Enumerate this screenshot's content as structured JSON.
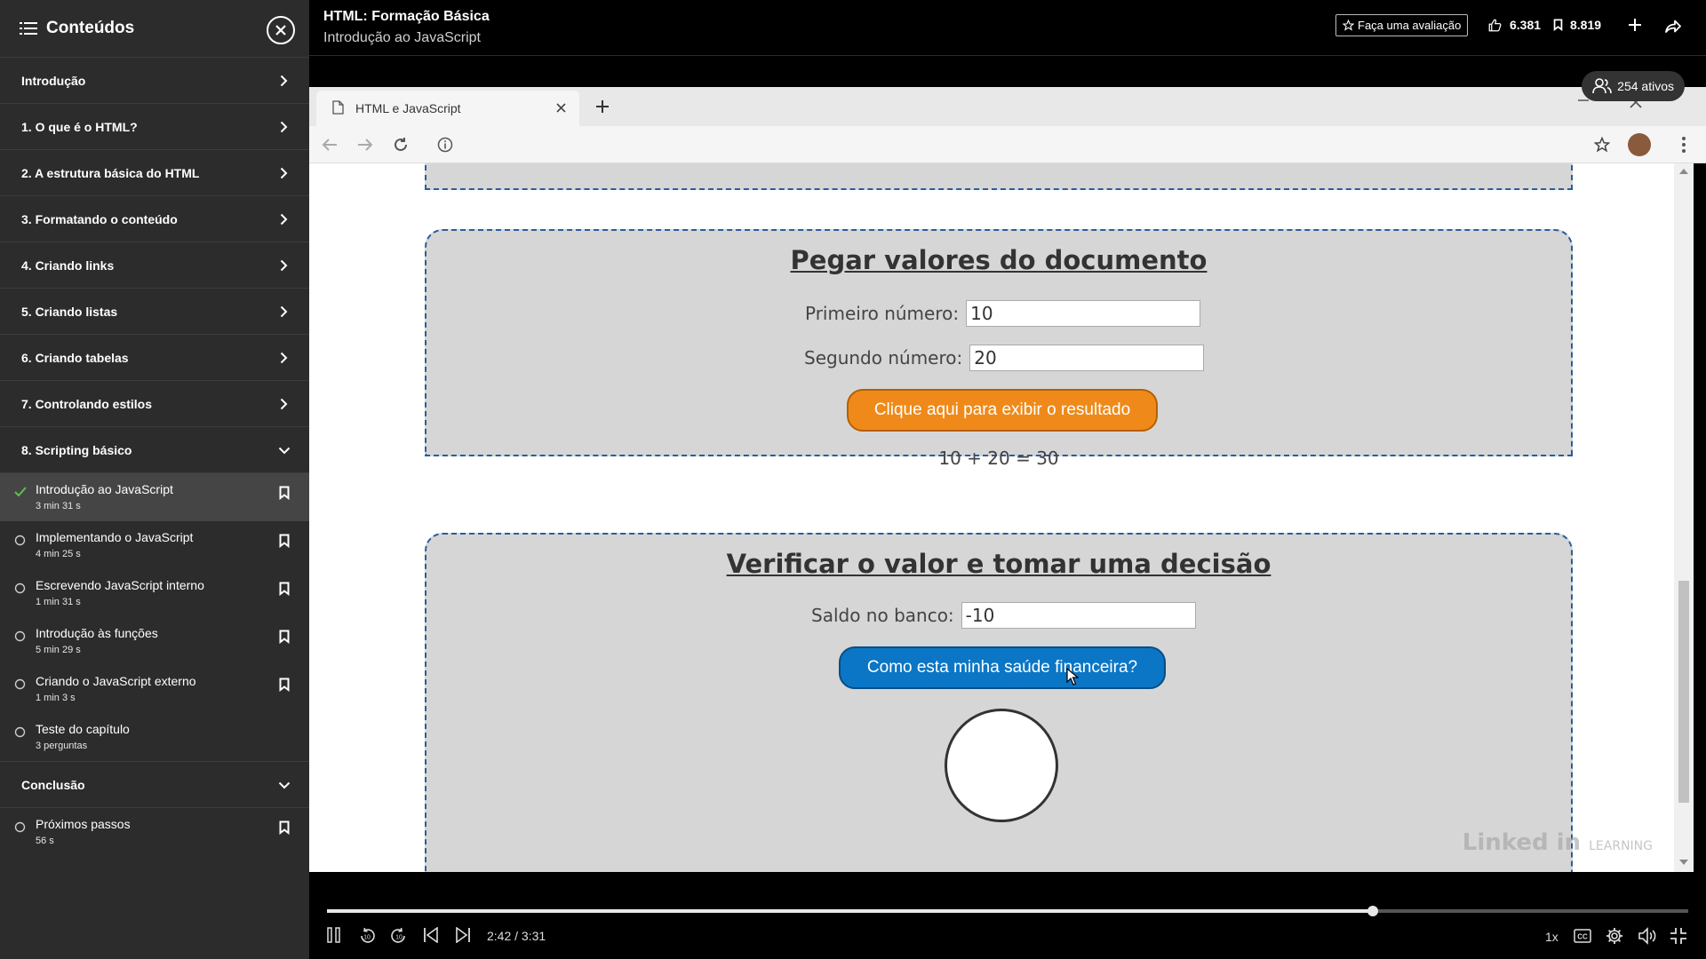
{
  "sidebar": {
    "title": "Conteúdos",
    "chapters": [
      {
        "label": "Introdução"
      },
      {
        "label": "1. O que é o HTML?"
      },
      {
        "label": "2. A estrutura básica do HTML"
      },
      {
        "label": "3. Formatando o conteúdo"
      },
      {
        "label": "4. Criando links"
      },
      {
        "label": "5. Criando listas"
      },
      {
        "label": "6. Criando tabelas"
      },
      {
        "label": "7. Controlando estilos"
      },
      {
        "label": "8. Scripting básico"
      }
    ],
    "lessons": [
      {
        "title": "Introdução ao JavaScript",
        "duration": "3 min 31 s"
      },
      {
        "title": "Implementando o JavaScript",
        "duration": "4 min 25 s"
      },
      {
        "title": "Escrevendo JavaScript interno",
        "duration": "1 min 31 s"
      },
      {
        "title": "Introdução às funções",
        "duration": "5 min 29 s"
      },
      {
        "title": "Criando o JavaScript externo",
        "duration": "1 min 3 s"
      },
      {
        "title": "Teste do capítulo",
        "duration": "3 perguntas"
      }
    ],
    "conclusion": {
      "label": "Conclusão",
      "lessons": [
        {
          "title": "Próximos passos",
          "duration": "56 s"
        }
      ]
    }
  },
  "topbar": {
    "course_title": "HTML: Formação Básica",
    "lesson_title": "Introdução ao JavaScript",
    "rate_label": "Faça uma avaliação",
    "likes": "6.381",
    "saves": "8.819"
  },
  "browser": {
    "tab_title": "HTML e JavaScript"
  },
  "viewers": "254 ativos",
  "page": {
    "section1": {
      "heading": "Pegar valores do documento",
      "first_label": "Primeiro número:",
      "first_value": "10",
      "second_label": "Segundo número:",
      "second_value": "20",
      "button": "Clique aqui para exibir o resultado",
      "result": "10 + 20 = 30"
    },
    "section2": {
      "heading": "Verificar o valor e tomar uma decisão",
      "balance_label": "Saldo no banco:",
      "balance_value": "-10",
      "button": "Como esta minha saúde financeira?"
    },
    "watermark_main": "Linked in",
    "watermark_sub": "LEARNING"
  },
  "player": {
    "time": "2:42 / 3:31",
    "speed": "1x",
    "progress": 0.768
  },
  "colors": {
    "accent_orange": "#ef8a1a",
    "accent_blue": "#0b76c5",
    "box_border": "#2a5d9a"
  }
}
